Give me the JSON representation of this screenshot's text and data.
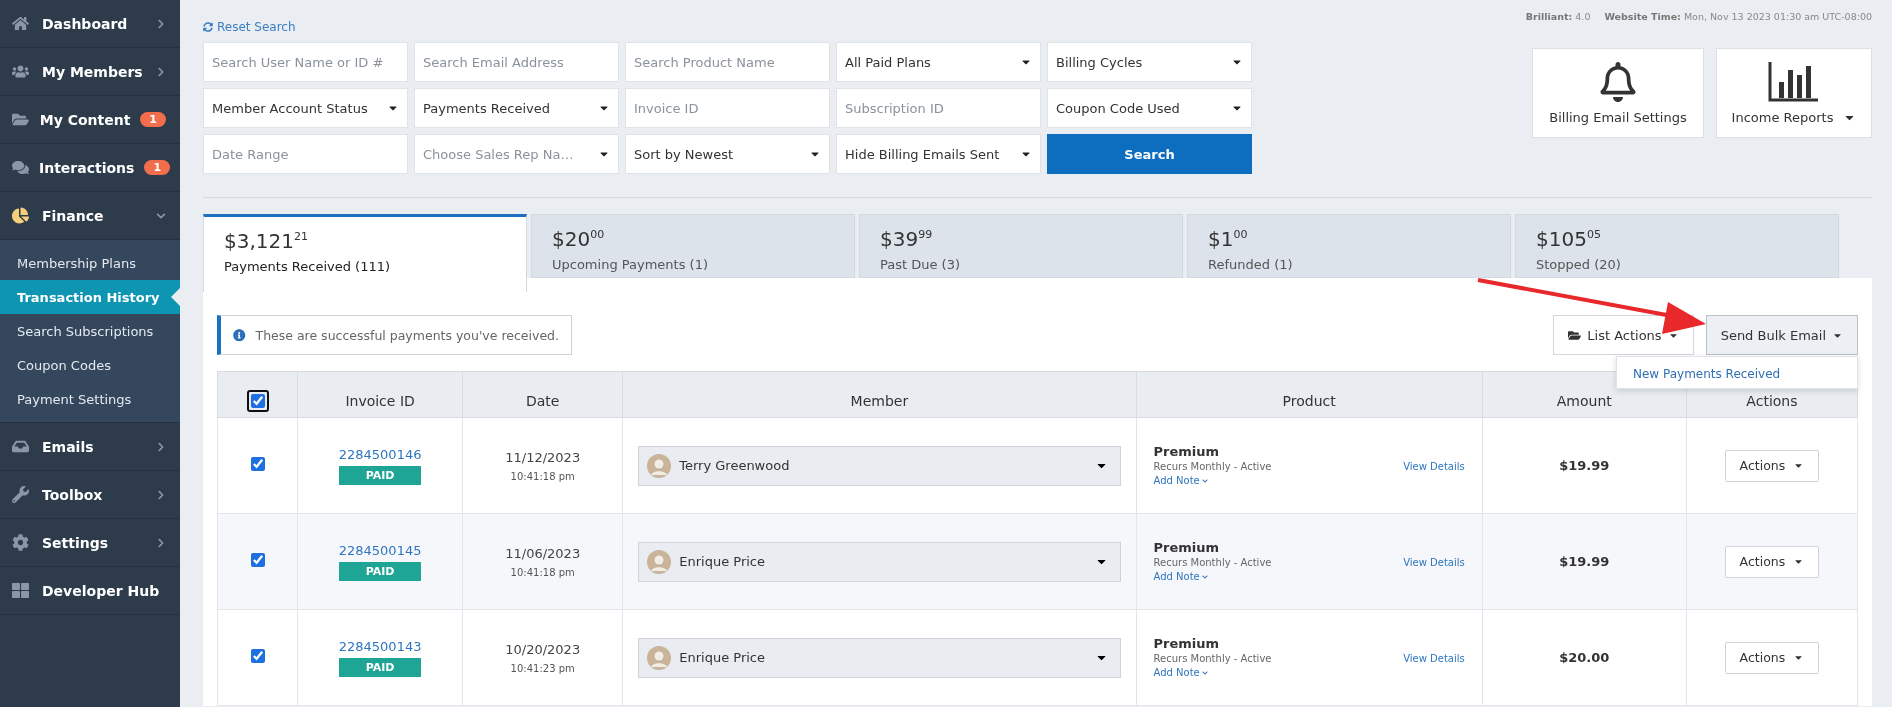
{
  "sidebar": {
    "items": [
      {
        "label": "Dashboard",
        "expanded": false
      },
      {
        "label": "My Members",
        "expanded": false
      },
      {
        "label": "My Content",
        "badge": "1"
      },
      {
        "label": "Interactions",
        "badge": "1"
      },
      {
        "label": "Finance",
        "expanded": true,
        "children": [
          {
            "label": "Membership Plans",
            "selected": false
          },
          {
            "label": "Transaction History",
            "selected": true
          },
          {
            "label": "Search Subscriptions",
            "selected": false
          },
          {
            "label": "Coupon Codes",
            "selected": false
          },
          {
            "label": "Payment Settings",
            "selected": false
          }
        ]
      },
      {
        "label": "Emails",
        "expanded": false
      },
      {
        "label": "Toolbox",
        "expanded": false
      },
      {
        "label": "Settings",
        "expanded": false
      },
      {
        "label": "Developer Hub"
      }
    ]
  },
  "reset_search": "Reset Search",
  "meta": [
    {
      "label": "Brilliant:",
      "value": "4.0"
    },
    {
      "label": "Website Time:",
      "value": "Mon, Nov 13 2023 01:30 am UTC-08:00"
    }
  ],
  "filters": [
    {
      "kind": "input",
      "placeholder": "Search User Name or ID #"
    },
    {
      "kind": "input",
      "placeholder": "Search Email Address"
    },
    {
      "kind": "input",
      "placeholder": "Search Product Name"
    },
    {
      "kind": "select",
      "value": "All Paid Plans"
    },
    {
      "kind": "select",
      "value": "Billing Cycles"
    },
    {
      "kind": "select",
      "value": "Member Account Status"
    },
    {
      "kind": "select",
      "value": "Payments Received"
    },
    {
      "kind": "input",
      "placeholder": "Invoice ID"
    },
    {
      "kind": "input",
      "placeholder": "Subscription ID"
    },
    {
      "kind": "select",
      "value": "Coupon Code Used"
    },
    {
      "kind": "input",
      "placeholder": "Date Range"
    },
    {
      "kind": "select",
      "placeholder": "Choose Sales Rep Na…"
    },
    {
      "kind": "select",
      "value": "Sort by Newest"
    },
    {
      "kind": "select",
      "value": "Hide Billing Emails Sent"
    },
    {
      "kind": "button",
      "label": "Search"
    }
  ],
  "tools": [
    {
      "kind": "bell",
      "label": "Billing Email Settings"
    },
    {
      "kind": "chart",
      "label": "Income Reports",
      "dropdown": true
    }
  ],
  "summary_tabs": [
    {
      "amount": "$3,121",
      "cents": "21",
      "label": "Payments Received (111)",
      "selected": true
    },
    {
      "amount": "$20",
      "cents": "00",
      "label": "Upcoming Payments (1)",
      "selected": false
    },
    {
      "amount": "$39",
      "cents": "99",
      "label": "Past Due (3)",
      "selected": false
    },
    {
      "amount": "$1",
      "cents": "00",
      "label": "Refunded (1)",
      "selected": false
    },
    {
      "amount": "$105",
      "cents": "05",
      "label": "Stopped (20)",
      "selected": false
    }
  ],
  "info": "These are successful payments you've received.",
  "list_actions": "List Actions",
  "bulk_email": {
    "label": "Send Bulk Email",
    "expanded": true,
    "menu": [
      "New Payments Received"
    ]
  },
  "table": {
    "all_checked": true,
    "columns": [
      "Invoice ID",
      "Date",
      "Member",
      "Product",
      "Amount",
      "Actions"
    ],
    "rows": [
      {
        "checked": true,
        "invoice": "2284500146",
        "status": "PAID",
        "date": "11/12/2023",
        "time": "10:41:18 pm",
        "member": "Terry Greenwood",
        "product": "Premium",
        "plan": "Recurs Monthly - Active",
        "details": "View Details",
        "note": "Add Note",
        "amount": "$19.99",
        "action": "Actions"
      },
      {
        "checked": true,
        "invoice": "2284500145",
        "status": "PAID",
        "date": "11/06/2023",
        "time": "10:41:18 pm",
        "member": "Enrique Price",
        "product": "Premium",
        "plan": "Recurs Monthly - Active",
        "details": "View Details",
        "note": "Add Note",
        "amount": "$19.99",
        "action": "Actions"
      },
      {
        "checked": true,
        "invoice": "2284500143",
        "status": "PAID",
        "date": "10/20/2023",
        "time": "10:41:23 pm",
        "member": "Enrique Price",
        "product": "Premium",
        "plan": "Recurs Monthly - Active",
        "details": "View Details",
        "note": "Add Note",
        "amount": "$20.00",
        "action": "Actions"
      }
    ]
  }
}
